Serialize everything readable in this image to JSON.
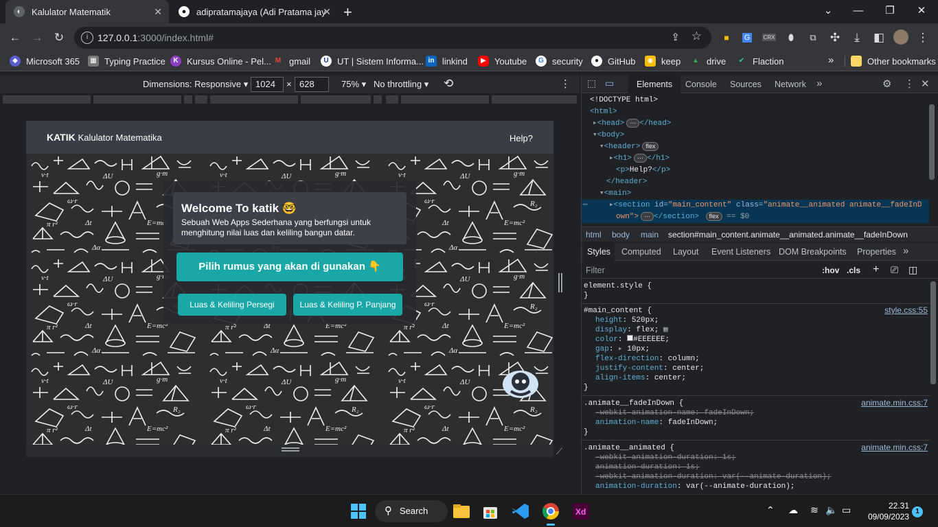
{
  "browser": {
    "tabs": [
      {
        "title": "Kalulator Matematik",
        "active": true
      },
      {
        "title": "adipratamajaya (Adi Pratama jaya)",
        "active": false
      }
    ],
    "new_tab": "+",
    "url_host": "127.0.0.1",
    "url_rest": ":3000/index.html#",
    "bookmarks": [
      "Microsoft 365",
      "Typing Practice",
      "Kursus Online - Pel...",
      "gmail",
      "UT | Sistem Informa...",
      "linkind",
      "Youtube",
      "security",
      "GitHub",
      "keep",
      "drive",
      "Flaction"
    ],
    "bookmarks_more": "»",
    "other_bookmarks": "Other bookmarks"
  },
  "device_toolbar": {
    "dimensions_label": "Dimensions: Responsive",
    "width": "1024",
    "times": "×",
    "height": "628",
    "zoom": "75%",
    "throttle": "No throttling"
  },
  "app": {
    "brand": "KATIK",
    "brand_sub": "Kalulator Matematika",
    "help": "Help?",
    "welcome_title": "Welcome To katik 🤓",
    "welcome_desc": "Sebuah Web Apps Sederhana yang berfungsi untuk menghitung nilai luas dan keliling bangun datar.",
    "choose_label": "Pilih rumus yang akan di gunakan 👇",
    "btn_square": "Luas & Keliling Persegi",
    "btn_rect": "Luas & Keliling P. Panjang"
  },
  "devtools": {
    "tabs": [
      "Elements",
      "Console",
      "Sources",
      "Network"
    ],
    "dom_lines": {
      "doctype": "<!DOCTYPE html>",
      "html_open": "<html>",
      "head": "<head>",
      "head_close": "</head>",
      "body": "<body>",
      "header": "<header>",
      "h1": "<h1>",
      "h1_close": "</h1>",
      "p_open": "<p>",
      "p_text": "Help?",
      "p_close": "</p>",
      "header_close": "</header>",
      "main": "<main>",
      "section_tag": "<section",
      "section_id_attr": "id=",
      "section_id_val": "\"main_content\"",
      "section_class_attr": "class=",
      "section_class_val": "\"animate__animated animate__fadeInD",
      "section_class_val2": "own\">",
      "section_close": "</section>",
      "flex": "flex",
      "ellipsis": "⋯",
      "dollar0": "== $0"
    },
    "breadcrumbs": [
      "html",
      "body",
      "main",
      "section#main_content.animate__animated.animate__fadeInDown"
    ],
    "style_tabs": [
      "Styles",
      "Computed",
      "Layout",
      "Event Listeners",
      "DOM Breakpoints",
      "Properties"
    ],
    "filter_placeholder": "Filter",
    "hov": ":hov",
    ".cls": ".cls",
    "rules": {
      "element_style": "element.style {",
      "close": "}",
      "main_selector": "#main_content {",
      "main_src": "style.css:55",
      "main_props": [
        {
          "p": "height",
          "v": "520px;"
        },
        {
          "p": "display",
          "v": "flex;"
        },
        {
          "p": "color",
          "v": "#EEEEEE;"
        },
        {
          "p": "gap",
          "v": "10px;"
        },
        {
          "p": "flex-direction",
          "v": "column;"
        },
        {
          "p": "justify-content",
          "v": "center;"
        },
        {
          "p": "align-items",
          "v": "center;"
        }
      ],
      "fade_selector": ".animate__fadeInDown {",
      "fade_src": "animate.min.css:7",
      "fade_props": [
        {
          "p": "-webkit-animation-name",
          "v": "fadeInDown;",
          "struck": true
        },
        {
          "p": "animation-name",
          "v": "fadeInDown;",
          "struck": false
        }
      ],
      "anim_selector": ".animate__animated {",
      "anim_src": "animate.min.css:7",
      "anim_props": [
        {
          "p": "-webkit-animation-duration",
          "v": "1s;",
          "struck": true
        },
        {
          "p": "animation-duration",
          "v": "1s;",
          "struck": true
        },
        {
          "p": "-webkit-animation-duration",
          "v": "var(--animate-duration);",
          "struck": true
        },
        {
          "p": "animation-duration",
          "v": "var(--animate-duration);",
          "struck": false
        }
      ]
    }
  },
  "taskbar": {
    "search": "Search",
    "time": "22.31",
    "date": "09/09/2023",
    "notif_count": "1"
  }
}
